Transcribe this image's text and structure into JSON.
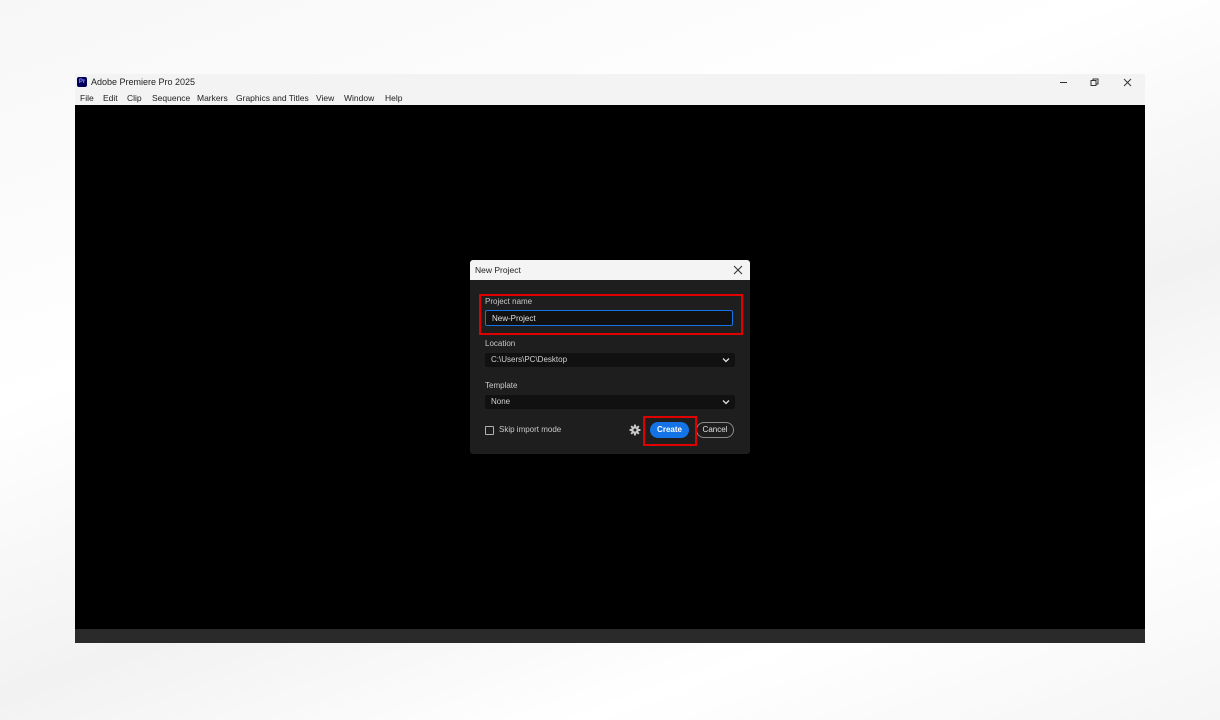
{
  "window": {
    "app_title": "Adobe Premiere Pro 2025",
    "app_icon_text": "Pr",
    "controls": {
      "minimize_icon": "minimize-icon",
      "restore_icon": "restore-icon",
      "close_icon": "close-icon"
    }
  },
  "menubar": {
    "items": [
      "File",
      "Edit",
      "Clip",
      "Sequence",
      "Markers",
      "Graphics and Titles",
      "View",
      "Window",
      "Help"
    ]
  },
  "dialog": {
    "title": "New Project",
    "close_icon": "close-icon",
    "project_name": {
      "label": "Project name",
      "value": "New-Project"
    },
    "location": {
      "label": "Location",
      "value": "C:\\Users\\PC\\Desktop"
    },
    "template": {
      "label": "Template",
      "value": "None"
    },
    "skip_import": {
      "label": "Skip import mode",
      "checked": false
    },
    "settings_icon": "gear-icon",
    "create_label": "Create",
    "cancel_label": "Cancel"
  },
  "colors": {
    "accent": "#1473e6",
    "highlight": "#e00000",
    "dialog_bg": "#1e1e1e",
    "workspace_bg": "#000000"
  }
}
